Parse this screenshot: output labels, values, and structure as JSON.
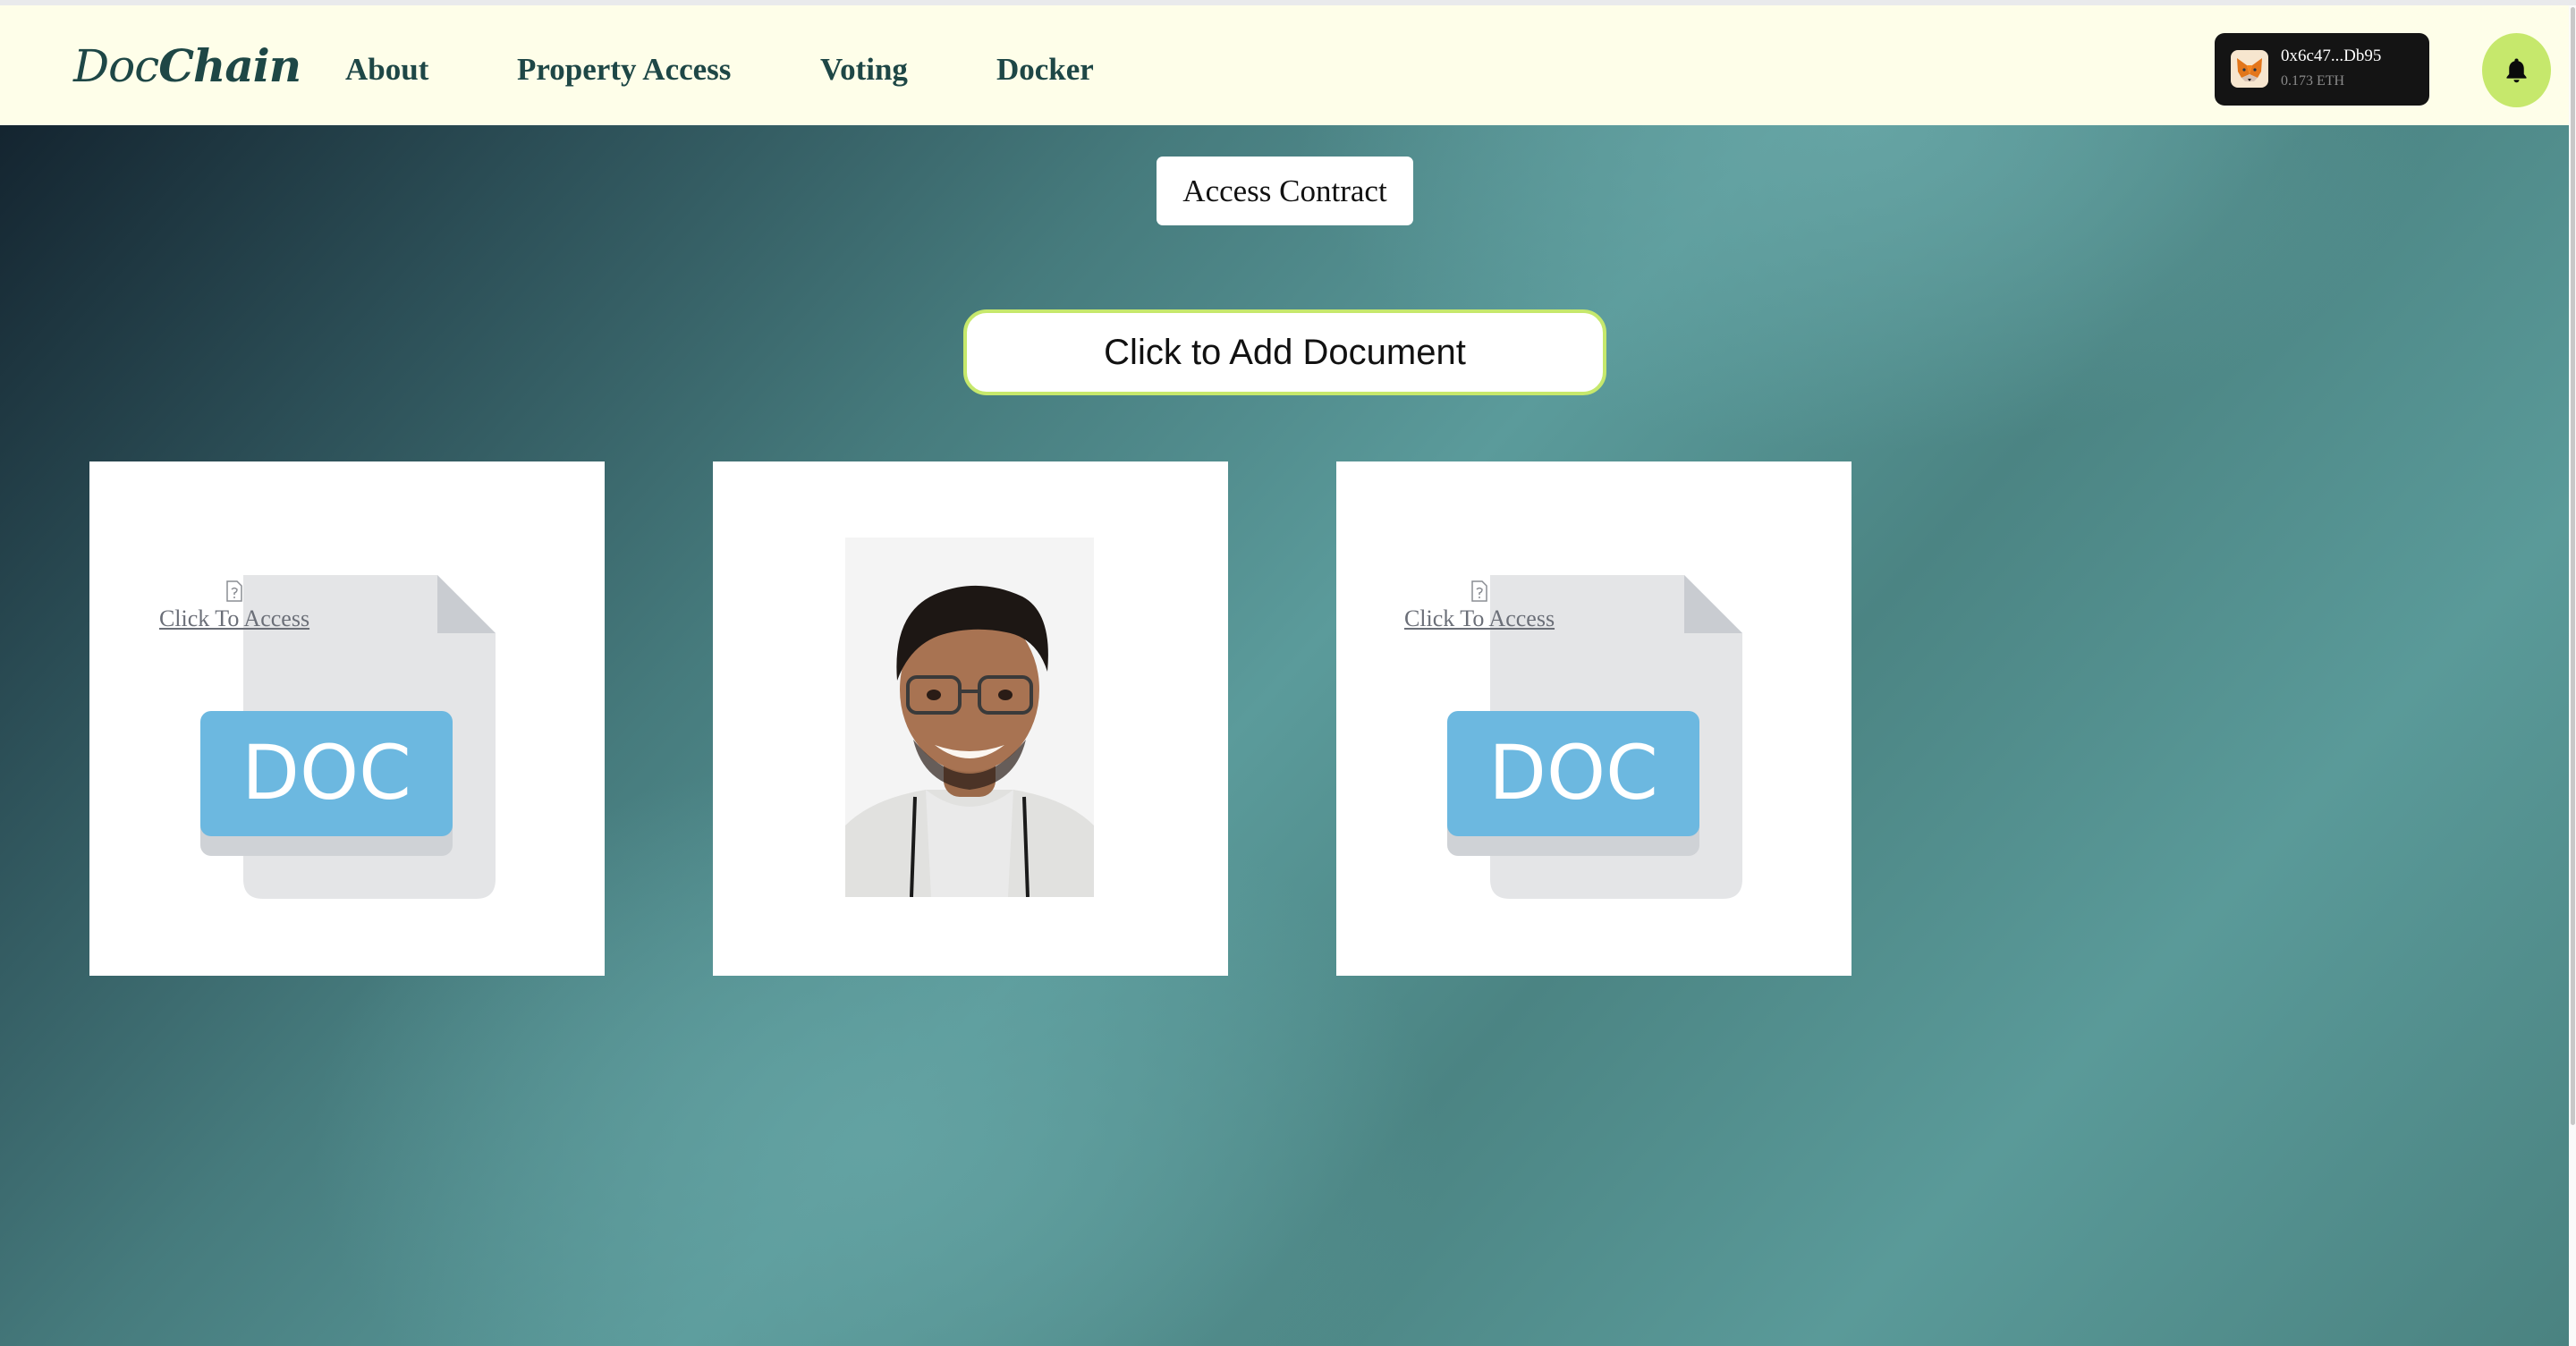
{
  "brand": {
    "logo_part1": "Doc",
    "logo_part2": "Chain"
  },
  "nav": {
    "links": [
      {
        "label": "About"
      },
      {
        "label": "Property Access"
      },
      {
        "label": "Voting"
      },
      {
        "label": "Docker"
      }
    ]
  },
  "wallet": {
    "address": "0x6c47...Db95",
    "balance": "0.173 ETH",
    "icon": "metamask-fox-icon"
  },
  "notifications": {
    "icon": "bell-icon"
  },
  "main": {
    "access_contract_label": "Access Contract",
    "add_document_label": "Click to Add Document"
  },
  "documents": [
    {
      "type": "doc",
      "file_label": "DOC",
      "access_label": "Click To Access"
    },
    {
      "type": "photo",
      "content": "portrait photo"
    },
    {
      "type": "doc",
      "file_label": "DOC",
      "access_label": "Click To Access"
    }
  ],
  "colors": {
    "navbar_bg": "#fefee9",
    "brand_text": "#1e4746",
    "accent_green": "#c6e86c",
    "doc_blue": "#6cb8e0",
    "wallet_bg": "#141414"
  }
}
